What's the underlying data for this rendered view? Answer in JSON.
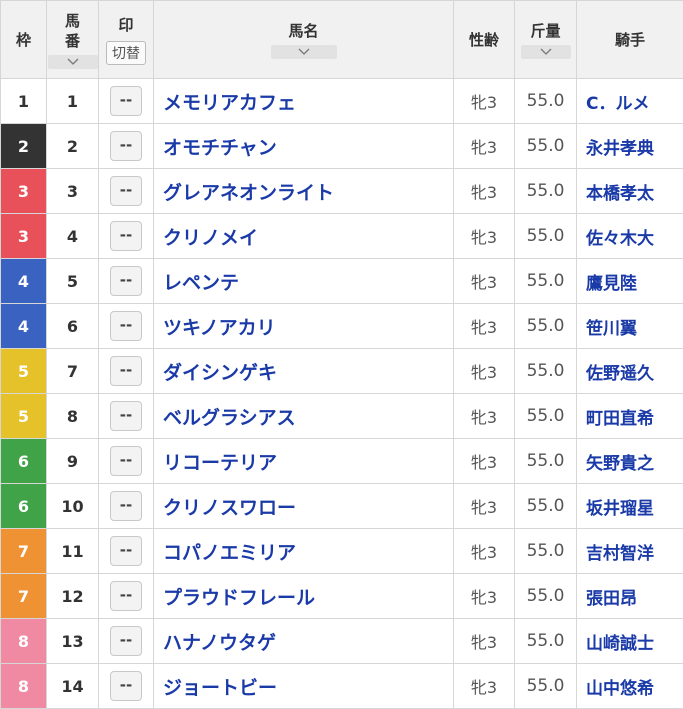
{
  "header": {
    "waku": "枠",
    "umaban": [
      "馬",
      "番"
    ],
    "mark": "印",
    "kirikae": "切替",
    "name": "馬名",
    "sexage": "性齢",
    "kinryo": "斤量",
    "jockey": "騎手"
  },
  "colors": {
    "1": {
      "bg": "#ffffff",
      "fg": "#333333"
    },
    "2": {
      "bg": "#333333",
      "fg": "#ffffff"
    },
    "3": {
      "bg": "#e8515a",
      "fg": "#ffffff"
    },
    "4": {
      "bg": "#3a62c0",
      "fg": "#ffffff"
    },
    "5": {
      "bg": "#e5c12a",
      "fg": "#ffffff"
    },
    "6": {
      "bg": "#41a348",
      "fg": "#ffffff"
    },
    "7": {
      "bg": "#ef9233",
      "fg": "#ffffff"
    },
    "8": {
      "bg": "#f08aa2",
      "fg": "#ffffff"
    }
  },
  "rows": [
    {
      "waku": "1",
      "umaban": "1",
      "mark": "--",
      "name": "メモリアカフェ",
      "sexage": "牝3",
      "kinryo": "55.0",
      "jockey": "C．ルメ"
    },
    {
      "waku": "2",
      "umaban": "2",
      "mark": "--",
      "name": "オモチチャン",
      "sexage": "牝3",
      "kinryo": "55.0",
      "jockey": "永井孝典"
    },
    {
      "waku": "3",
      "umaban": "3",
      "mark": "--",
      "name": "グレアネオンライト",
      "sexage": "牝3",
      "kinryo": "55.0",
      "jockey": "本橋孝太"
    },
    {
      "waku": "3",
      "umaban": "4",
      "mark": "--",
      "name": "クリノメイ",
      "sexage": "牝3",
      "kinryo": "55.0",
      "jockey": "佐々木大"
    },
    {
      "waku": "4",
      "umaban": "5",
      "mark": "--",
      "name": "レペンテ",
      "sexage": "牝3",
      "kinryo": "55.0",
      "jockey": "鷹見陸"
    },
    {
      "waku": "4",
      "umaban": "6",
      "mark": "--",
      "name": "ツキノアカリ",
      "sexage": "牝3",
      "kinryo": "55.0",
      "jockey": "笹川翼"
    },
    {
      "waku": "5",
      "umaban": "7",
      "mark": "--",
      "name": "ダイシンゲキ",
      "sexage": "牝3",
      "kinryo": "55.0",
      "jockey": "佐野遥久"
    },
    {
      "waku": "5",
      "umaban": "8",
      "mark": "--",
      "name": "ベルグラシアス",
      "sexage": "牝3",
      "kinryo": "55.0",
      "jockey": "町田直希"
    },
    {
      "waku": "6",
      "umaban": "9",
      "mark": "--",
      "name": "リコーテリア",
      "sexage": "牝3",
      "kinryo": "55.0",
      "jockey": "矢野貴之"
    },
    {
      "waku": "6",
      "umaban": "10",
      "mark": "--",
      "name": "クリノスワロー",
      "sexage": "牝3",
      "kinryo": "55.0",
      "jockey": "坂井瑠星"
    },
    {
      "waku": "7",
      "umaban": "11",
      "mark": "--",
      "name": "コパノエミリア",
      "sexage": "牝3",
      "kinryo": "55.0",
      "jockey": "吉村智洋"
    },
    {
      "waku": "7",
      "umaban": "12",
      "mark": "--",
      "name": "プラウドフレール",
      "sexage": "牝3",
      "kinryo": "55.0",
      "jockey": "張田昂"
    },
    {
      "waku": "8",
      "umaban": "13",
      "mark": "--",
      "name": "ハナノウタゲ",
      "sexage": "牝3",
      "kinryo": "55.0",
      "jockey": "山崎誠士"
    },
    {
      "waku": "8",
      "umaban": "14",
      "mark": "--",
      "name": "ジョートビー",
      "sexage": "牝3",
      "kinryo": "55.0",
      "jockey": "山中悠希"
    }
  ]
}
